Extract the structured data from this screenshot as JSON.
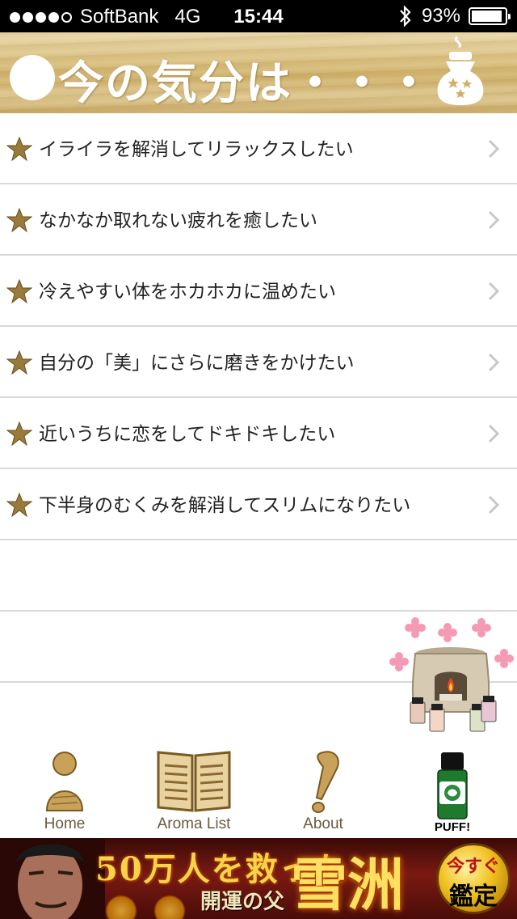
{
  "status_bar": {
    "carrier": "SoftBank",
    "network": "4G",
    "time": "15:44",
    "battery": "93%",
    "battery_level": 0.93,
    "signal_bars": 5,
    "signal_filled": 4
  },
  "header": {
    "title": "今の気分は・・・"
  },
  "list": {
    "items": [
      {
        "label": "イライラを解消してリラックスしたい"
      },
      {
        "label": "なかなか取れない疲れを癒したい"
      },
      {
        "label": "冷えやすい体をホカホカに温めたい"
      },
      {
        "label": "自分の「美」にさらに磨きをかけたい"
      },
      {
        "label": "近いうちに恋をしてドキドキしたい"
      },
      {
        "label": "下半身のむくみを解消してスリムになりたい"
      }
    ]
  },
  "tab_bar": {
    "tabs": [
      {
        "label": "Home",
        "icon": "wooden-person-icon"
      },
      {
        "label": "Aroma List",
        "icon": "wooden-book-icon"
      },
      {
        "label": "About",
        "icon": "wooden-exclamation-icon"
      },
      {
        "label": "PUFF!",
        "icon": "aroma-bottle-icon"
      }
    ]
  },
  "ad_banner": {
    "headline": "50万人を救った",
    "subline": "開運の父",
    "name": "雪洲",
    "badge_top": "今すぐ",
    "badge_bottom": "鑑定"
  },
  "colors": {
    "header_wood": "#d9bf7f",
    "star": "#9a7a3a",
    "separator": "#d9d9d9",
    "tab_label": "#6b5a3a"
  }
}
